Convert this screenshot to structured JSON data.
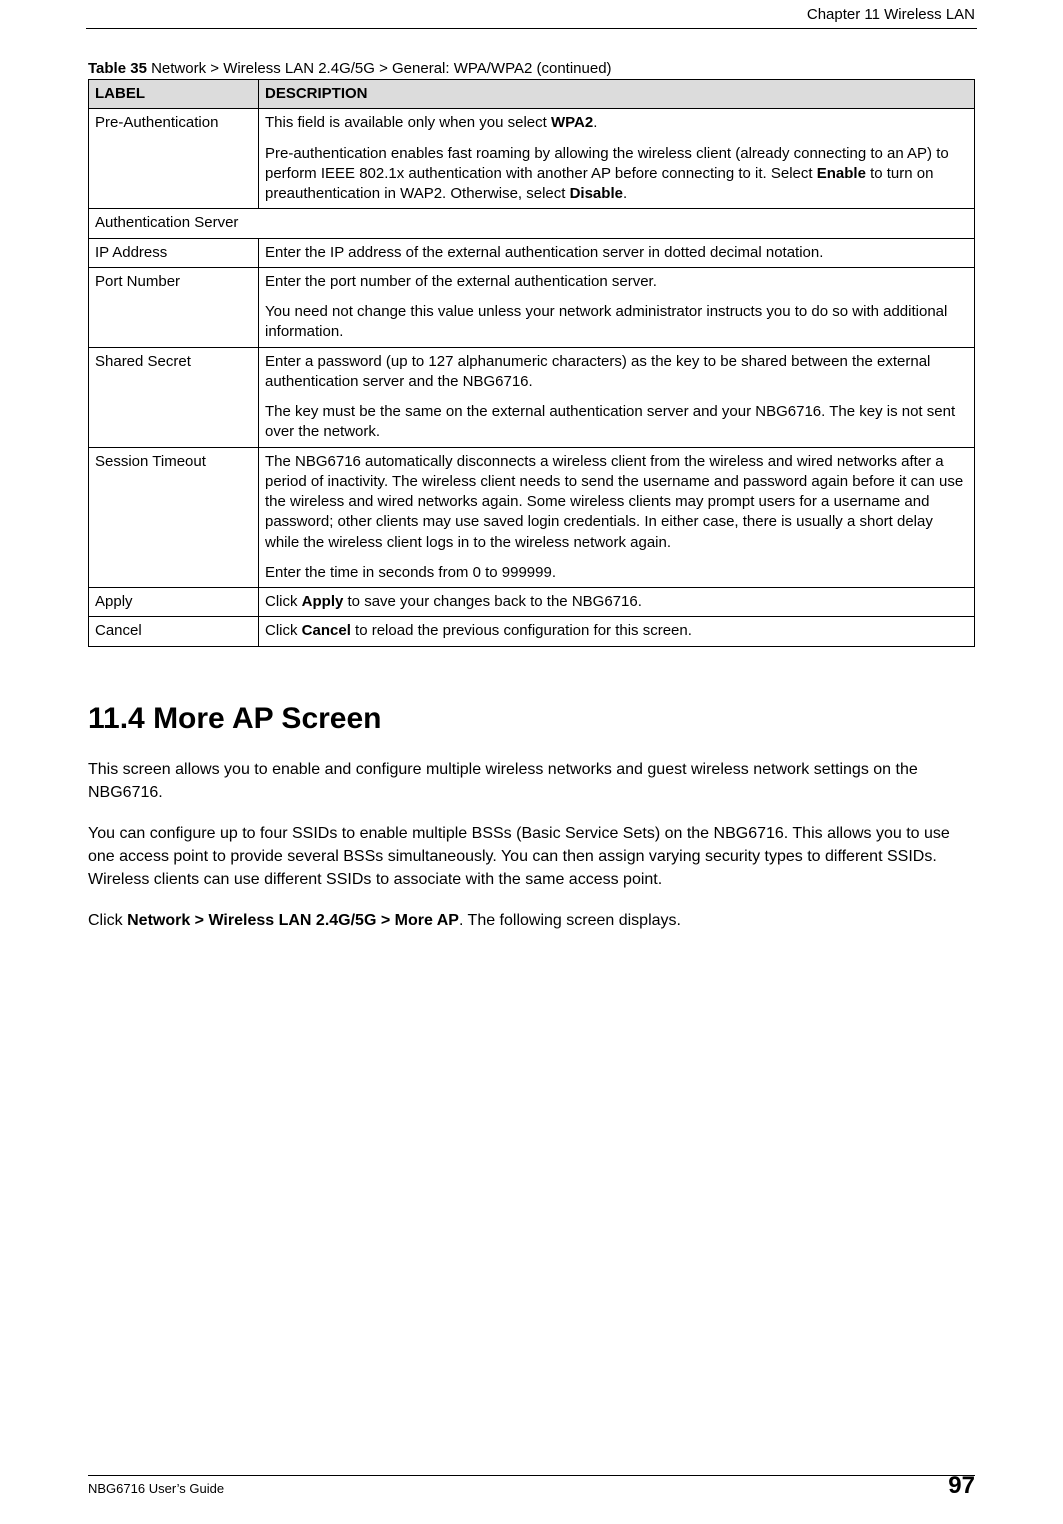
{
  "header": {
    "chapter": "Chapter 11 Wireless LAN"
  },
  "table": {
    "caption_prefix": "Table 35",
    "caption_rest": "   Network > Wireless LAN 2.4G/5G > General: WPA/WPA2 (continued)",
    "col_label": "LABEL",
    "col_desc": "DESCRIPTION",
    "rows": [
      {
        "label": "Pre-Authentication",
        "desc_html": "This field is available only when you select <b>WPA2</b>.|Pre-authentication enables fast roaming by allowing the wireless client (already connecting to an AP) to perform IEEE 802.1x authentication with another AP before connecting to it. Select <b>Enable</b> to turn on preauthentication in WAP2. Otherwise, select <b>Disable</b>."
      },
      {
        "label": "Authentication Server",
        "span": true
      },
      {
        "label": "IP Address",
        "desc_html": "Enter the IP address of the external authentication server in dotted decimal notation."
      },
      {
        "label": "Port Number",
        "desc_html": "Enter the port number of the external authentication server.|You need not change this value unless your network administrator instructs you to do so with additional information."
      },
      {
        "label": "Shared Secret",
        "desc_html": "Enter a password (up to 127 alphanumeric characters) as the key to be shared between the external authentication server and the NBG6716.|The key must be the same on the external authentication server and your NBG6716. The key is not sent over the network."
      },
      {
        "label": "Session Timeout",
        "desc_html": "The NBG6716 automatically disconnects a wireless client from the wireless and wired networks after a period of inactivity. The wireless client needs to send the username and password again before it can use the wireless and wired networks again. Some wireless clients may prompt users for a username and password; other clients may use saved login credentials. In either case, there is usually a short delay while the wireless client logs in to the wireless network again.|Enter the time in seconds from 0 to 999999."
      },
      {
        "label": "Apply",
        "desc_html": "Click <b>Apply</b> to save your changes back to the NBG6716."
      },
      {
        "label": "Cancel",
        "desc_html": "Click <b>Cancel</b> to reload the previous configuration for this screen."
      }
    ]
  },
  "section": {
    "heading": "11.4  More AP Screen",
    "paragraphs": [
      "This screen allows you to enable and configure multiple wireless networks and guest wireless network settings on the NBG6716.",
      "You can configure up to four SSIDs to enable multiple BSSs (Basic Service Sets) on the NBG6716. This allows you to use one access point to provide several BSSs simultaneously. You can then assign varying security types to different SSIDs. Wireless clients can use different SSIDs to associate with the same access point.",
      "Click <b>Network > Wireless LAN 2.4G/5G > More AP</b>. The following screen displays."
    ]
  },
  "footer": {
    "guide": "NBG6716 User’s Guide",
    "page": "97"
  }
}
